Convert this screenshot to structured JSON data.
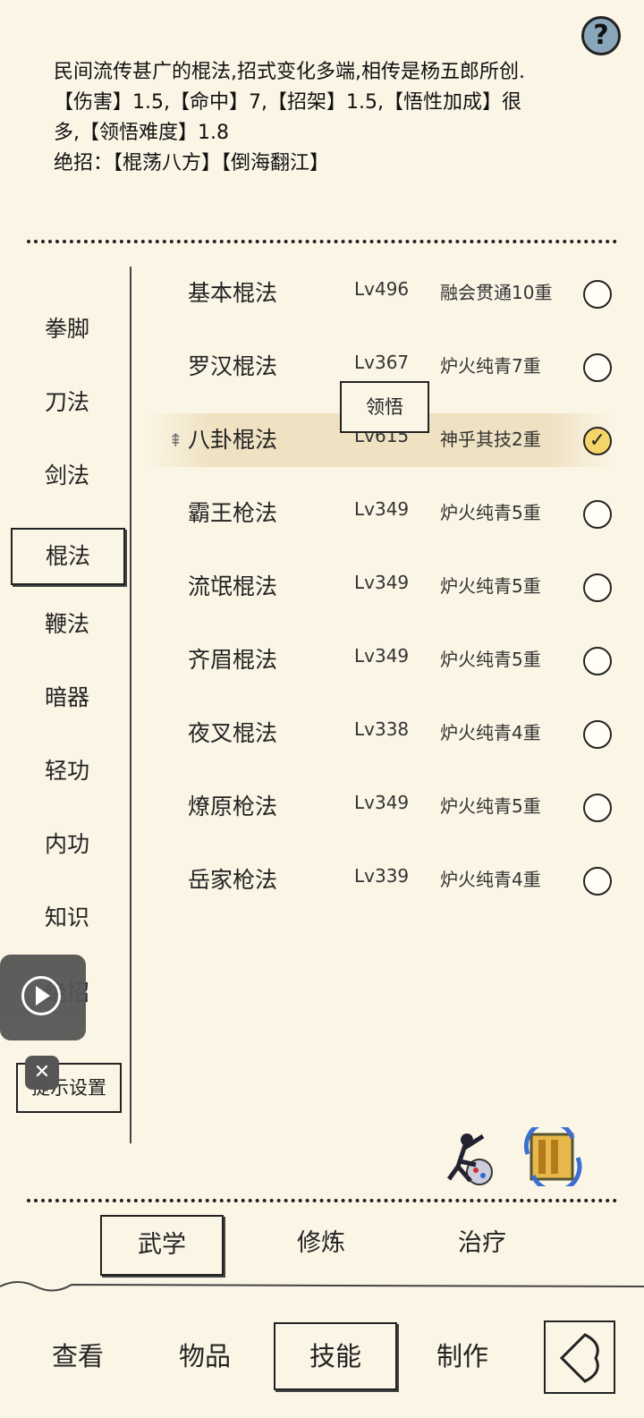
{
  "help_label": "?",
  "description": {
    "line1": "民间流传甚广的棍法,招式变化多端,相传是杨五郎所创.",
    "line2": "【伤害】1.5,【命中】7,【招架】1.5,【悟性加成】很",
    "line3": "多,【领悟难度】1.8",
    "line4": "绝招：【棍荡八方】【倒海翻江】"
  },
  "categories": [
    "拳脚",
    "刀法",
    "剑法",
    "棍法",
    "鞭法",
    "暗器",
    "轻功",
    "内功",
    "知识",
    "绝招"
  ],
  "selected_category": "棍法",
  "hint_settings": "提示设置",
  "skills": [
    {
      "name": "基本棍法",
      "level": "Lv496",
      "rank": "融会贯通10重",
      "checked": false
    },
    {
      "name": "罗汉棍法",
      "level": "Lv367",
      "rank": "炉火纯青7重",
      "checked": false
    },
    {
      "name": "八卦棍法",
      "level": "Lv615",
      "rank": "神乎其技2重",
      "checked": true
    },
    {
      "name": "霸王枪法",
      "level": "Lv349",
      "rank": "炉火纯青5重",
      "checked": false
    },
    {
      "name": "流氓棍法",
      "level": "Lv349",
      "rank": "炉火纯青5重",
      "checked": false
    },
    {
      "name": "齐眉棍法",
      "level": "Lv349",
      "rank": "炉火纯青5重",
      "checked": false
    },
    {
      "name": "夜叉棍法",
      "level": "Lv338",
      "rank": "炉火纯青4重",
      "checked": false
    },
    {
      "name": "燎原枪法",
      "level": "Lv349",
      "rank": "炉火纯青5重",
      "checked": false
    },
    {
      "name": "岳家枪法",
      "level": "Lv339",
      "rank": "炉火纯青4重",
      "checked": false
    }
  ],
  "tooltip": "领悟",
  "check_mark": "✓",
  "sub_tabs": [
    "武学",
    "修炼",
    "治疗"
  ],
  "bottom_tabs": [
    "查看",
    "物品",
    "技能",
    "制作"
  ],
  "close_label": "✕",
  "arrow_icon": "⇞"
}
